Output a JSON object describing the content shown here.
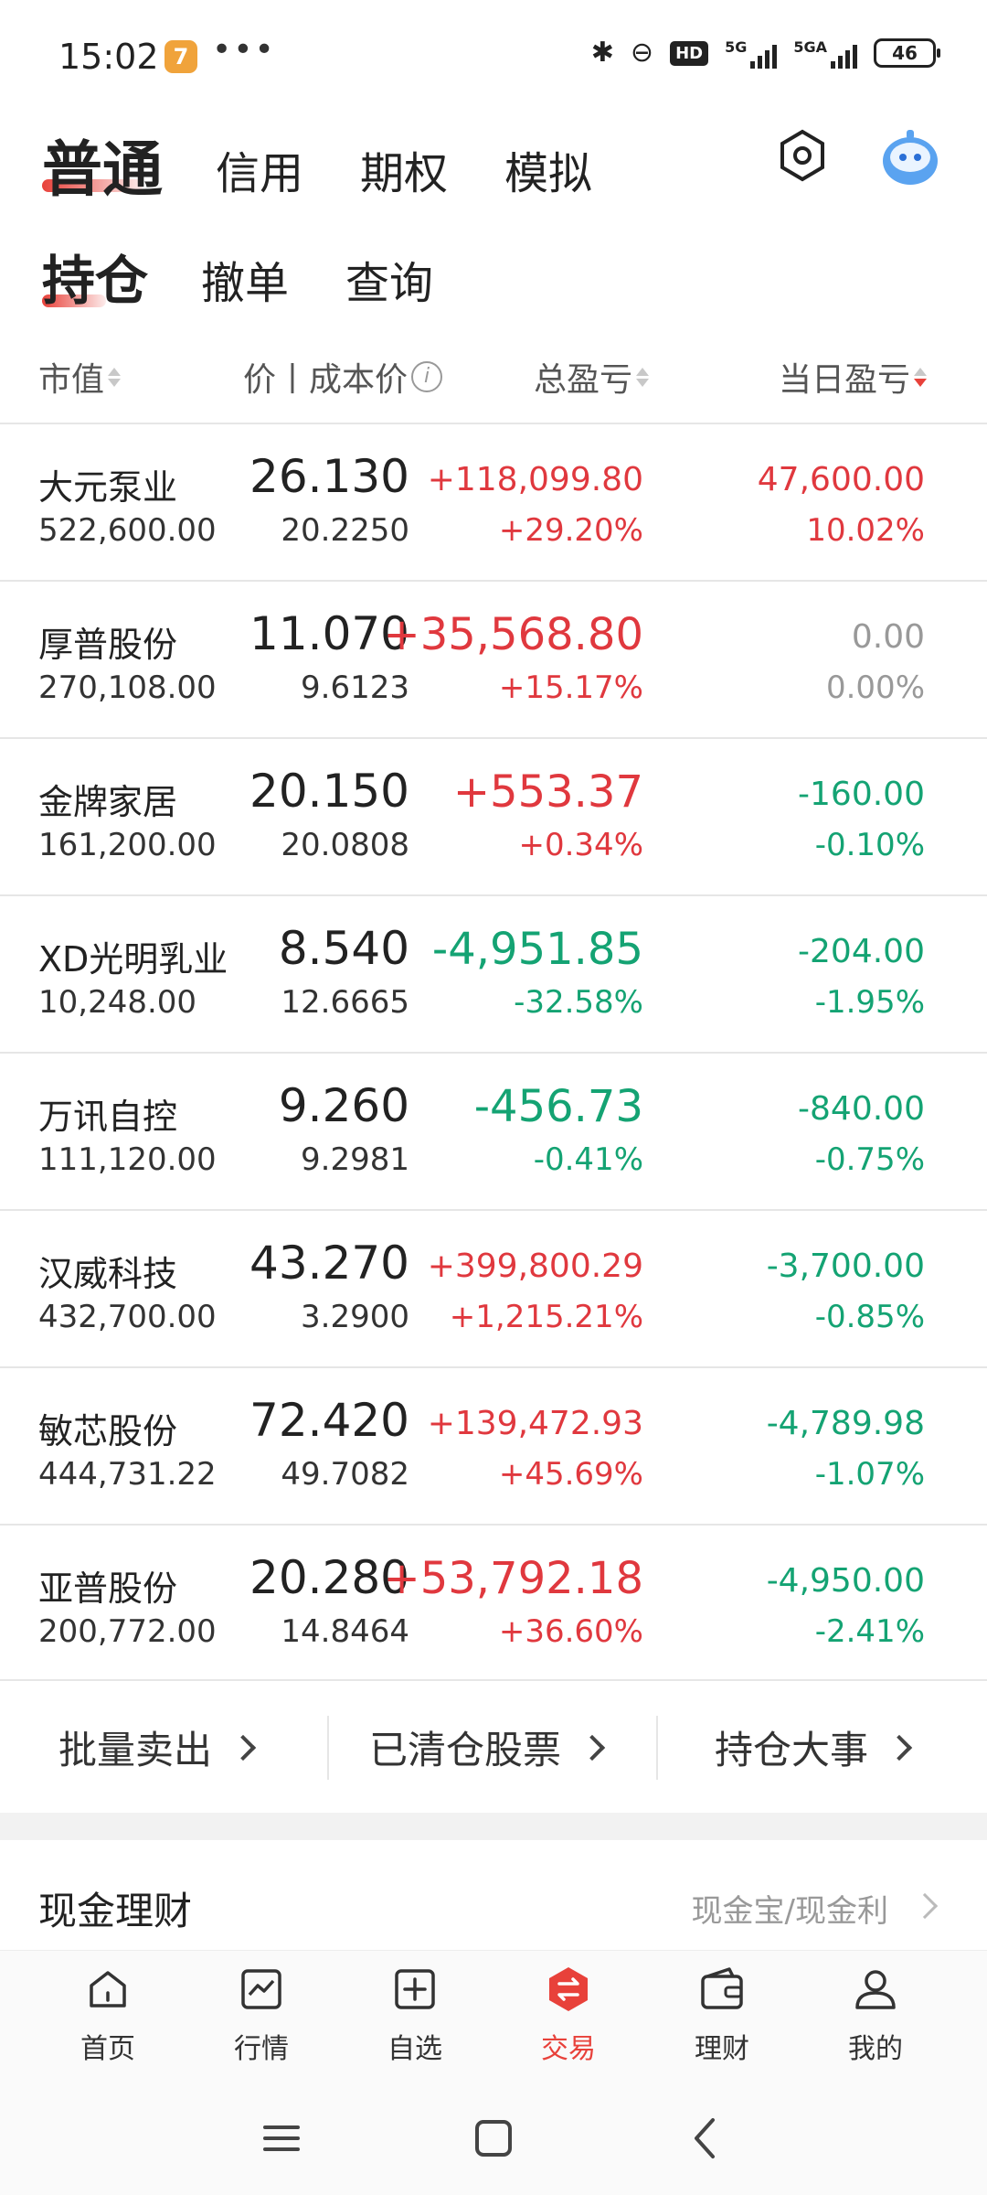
{
  "status_bar": {
    "time": "15:02",
    "app_badge": "7",
    "dots": "•••",
    "hd": "HD",
    "net1": "5G",
    "net2": "5GA",
    "battery": "46"
  },
  "top_tabs": [
    "普通",
    "信用",
    "期权",
    "模拟"
  ],
  "sub_tabs": [
    "持仓",
    "撤单",
    "查询"
  ],
  "columns": {
    "market_value": "市值",
    "price_cost": "价丨成本价",
    "total_pl": "总盈亏",
    "daily_pl": "当日盈亏"
  },
  "holdings": [
    {
      "name": "大元泵业",
      "market_value": "522,600.00",
      "price": "26.130",
      "cost": "20.2250",
      "total_pl": "+118,099.80",
      "total_pct": "+29.20%",
      "day_pl": "47,600.00",
      "day_pct": "10.02%"
    },
    {
      "name": "厚普股份",
      "market_value": "270,108.00",
      "price": "11.070",
      "cost": "9.6123",
      "total_pl": "+35,568.80",
      "total_pct": "+15.17%",
      "day_pl": "0.00",
      "day_pct": "0.00%"
    },
    {
      "name": "金牌家居",
      "market_value": "161,200.00",
      "price": "20.150",
      "cost": "20.0808",
      "total_pl": "+553.37",
      "total_pct": "+0.34%",
      "day_pl": "-160.00",
      "day_pct": "-0.10%"
    },
    {
      "name": "XD光明乳业",
      "market_value": "10,248.00",
      "price": "8.540",
      "cost": "12.6665",
      "total_pl": "-4,951.85",
      "total_pct": "-32.58%",
      "day_pl": "-204.00",
      "day_pct": "-1.95%"
    },
    {
      "name": "万讯自控",
      "market_value": "111,120.00",
      "price": "9.260",
      "cost": "9.2981",
      "total_pl": "-456.73",
      "total_pct": "-0.41%",
      "day_pl": "-840.00",
      "day_pct": "-0.75%"
    },
    {
      "name": "汉威科技",
      "market_value": "432,700.00",
      "price": "43.270",
      "cost": "3.2900",
      "total_pl": "+399,800.29",
      "total_pct": "+1,215.21%",
      "day_pl": "-3,700.00",
      "day_pct": "-0.85%"
    },
    {
      "name": "敏芯股份",
      "market_value": "444,731.22",
      "price": "72.420",
      "cost": "49.7082",
      "total_pl": "+139,472.93",
      "total_pct": "+45.69%",
      "day_pl": "-4,789.98",
      "day_pct": "-1.07%"
    },
    {
      "name": "亚普股份",
      "market_value": "200,772.00",
      "price": "20.280",
      "cost": "14.8464",
      "total_pl": "+53,792.18",
      "total_pct": "+36.60%",
      "day_pl": "-4,950.00",
      "day_pct": "-2.41%"
    }
  ],
  "actions": [
    "批量卖出",
    "已清仓股票",
    "持仓大事"
  ],
  "cash": {
    "title": "现金理财",
    "link": "现金宝/现金利"
  },
  "bottom_nav": [
    "首页",
    "行情",
    "自选",
    "交易",
    "理财",
    "我的"
  ],
  "colors": {
    "up": "#e0383e",
    "down": "#14a373",
    "neutral": "#999999",
    "accent": "#e8413a"
  }
}
